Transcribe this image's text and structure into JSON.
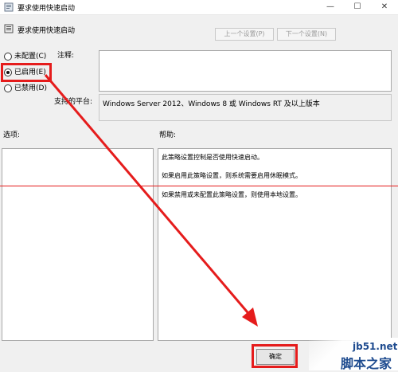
{
  "window": {
    "title": "要求使用快速启动",
    "controls": {
      "minimize": "—",
      "maximize": "☐",
      "close": "✕"
    }
  },
  "header": {
    "policy_title": "要求使用快速启动",
    "prev_button": "上一个设置(P)",
    "next_button": "下一个设置(N)"
  },
  "state_options": [
    {
      "label": "未配置(C)",
      "selected": false
    },
    {
      "label": "已启用(E)",
      "selected": true
    },
    {
      "label": "已禁用(D)",
      "selected": false
    }
  ],
  "comment": {
    "label": "注释:",
    "value": ""
  },
  "supported": {
    "label": "支持的平台:",
    "value": "Windows Server 2012、Windows 8 或 Windows RT 及以上版本"
  },
  "options_section": {
    "label": "选项:"
  },
  "help_section": {
    "label": "帮助:",
    "lines": [
      "此策略设置控制是否使用快速启动。",
      "如果启用此策略设置，则系统需要启用休眠模式。",
      "如果禁用或未配置此策略设置，则使用本地设置。"
    ]
  },
  "footer": {
    "ok_button": "确定"
  },
  "annotation": {
    "color": "#e51c1c"
  },
  "watermark": {
    "site": "jb51.net",
    "brand": "脚本之家"
  }
}
